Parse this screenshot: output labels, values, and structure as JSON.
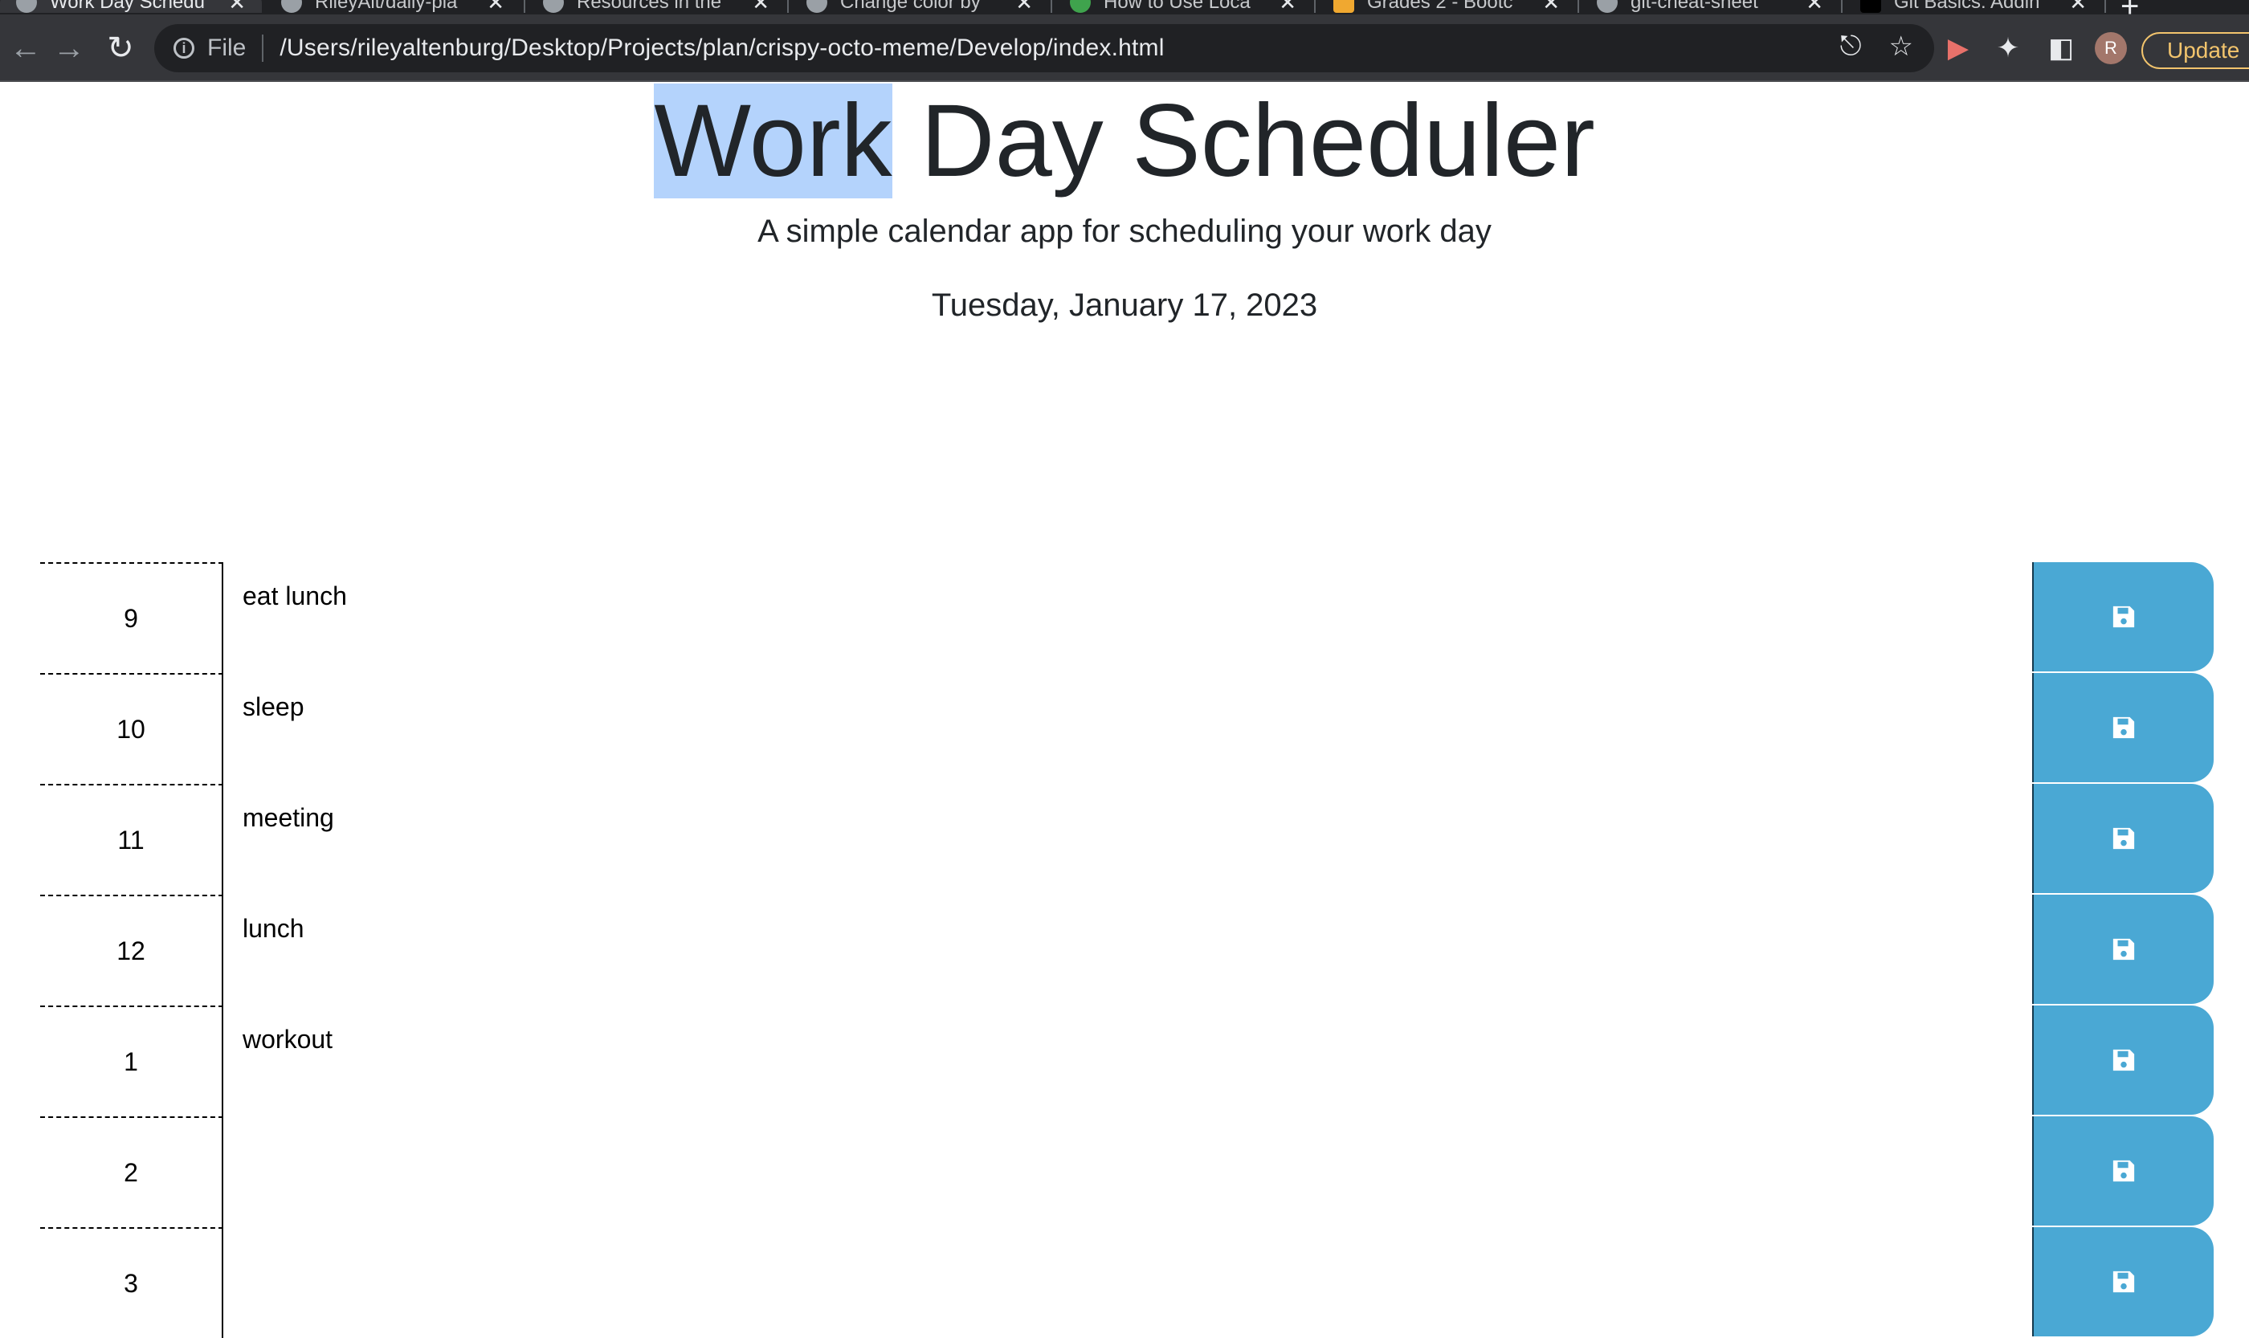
{
  "browser": {
    "tabs": [
      {
        "title": "Work Day Schedu"
      },
      {
        "title": "RileyAlt/daily-pla"
      },
      {
        "title": "Resources in the"
      },
      {
        "title": "Change color by"
      },
      {
        "title": "How to Use Loca"
      },
      {
        "title": "Grades 2 - Bootc"
      },
      {
        "title": "git-cheat-sheet"
      },
      {
        "title": "Git Basics: Addin"
      }
    ],
    "url_scheme": "File",
    "url": "/Users/rileyaltenburg/Desktop/Projects/plan/crispy-octo-meme/Develop/index.html",
    "avatar_letter": "R",
    "update_label": "Update"
  },
  "header": {
    "title_selected": "Work",
    "title_rest": " Day Scheduler",
    "lead": "A simple calendar app for scheduling your work day",
    "current_day": "Tuesday, January 17, 2023"
  },
  "colors": {
    "save_button": "#4aa8d4",
    "selection": "#b4d3fc"
  },
  "timeblocks": [
    {
      "hour": "9",
      "text": "eat lunch"
    },
    {
      "hour": "10",
      "text": "sleep"
    },
    {
      "hour": "11",
      "text": "meeting"
    },
    {
      "hour": "12",
      "text": "lunch"
    },
    {
      "hour": "1",
      "text": "workout"
    },
    {
      "hour": "2",
      "text": ""
    },
    {
      "hour": "3",
      "text": ""
    }
  ]
}
